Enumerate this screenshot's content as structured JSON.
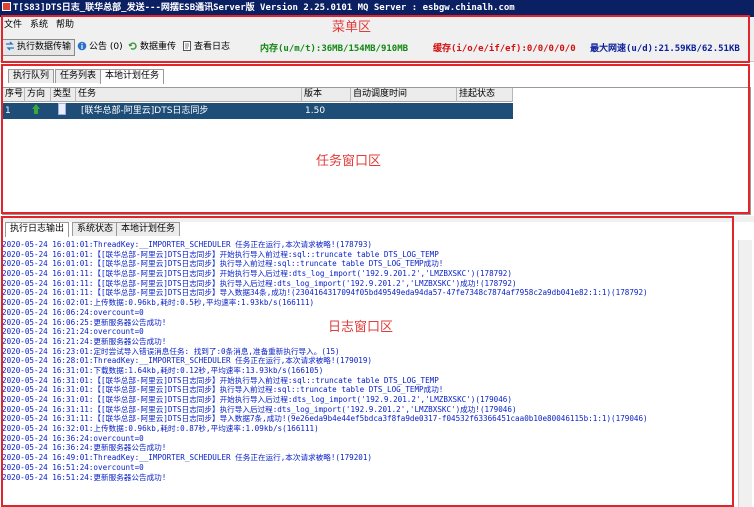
{
  "window": {
    "title": "T[S83]DTS日志_联华总部_发送---网摆ESB通讯Server版  Version 2.25.0101 MQ Server : esbgw.chinalh.com"
  },
  "menu": [
    "文件",
    "系统",
    "帮助"
  ],
  "toolbar": {
    "buttons": [
      {
        "label": "执行数据传输",
        "icon": "transfer-icon"
      },
      {
        "label": "公告 (0)",
        "icon": "info-icon"
      },
      {
        "label": "数据重传",
        "icon": "resend-icon"
      },
      {
        "label": "查看日志",
        "icon": "document-icon"
      }
    ],
    "memory": "内存(u/m/t):36MB/154MB/910MB",
    "cache": "缓存(i/o/e/if/ef):0/0/0/0/0",
    "speed": "最大网速(u/d):21.59KB/62.51KB"
  },
  "annotations": {
    "menu_area": "菜单区",
    "task_area": "任务窗口区",
    "log_area": "日志窗口区"
  },
  "colors": {
    "title_bg": "#0b1f63",
    "selected_row": "#1e4d78",
    "stat_green": "#118811",
    "stat_red": "#d01010",
    "stat_blue": "#0b1f9a",
    "log_text": "#0a22c9",
    "annotation_red": "#e0262b"
  },
  "task_tabs": [
    "执行队列",
    "任务列表",
    "本地计划任务"
  ],
  "task_table": {
    "headers": [
      "序号",
      "方向",
      "类型",
      "任务",
      "版本",
      "自动调度时间",
      "挂起状态"
    ],
    "rows": [
      {
        "index": "1",
        "direction_icon": "upload-arrow-icon",
        "type_icon": "file-icon",
        "task": "[联华总部-阿里云]DTS日志同步",
        "version": "1.50",
        "schedule": "",
        "suspend": ""
      }
    ]
  },
  "log_tabs": [
    "执行日志输出",
    "系统状态",
    "本地计划任务"
  ],
  "log_lines": [
    "2020-05-24 16:01:01:ThreadKey:__IMPORTER_SCHEDULER 任务正在运行,本次请求被略!(178793)",
    "2020-05-24 16:01:01:【[联华总部-阿里云]DTS日志同步】开始执行导入前过程:sql::truncate table DTS_LOG_TEMP",
    "2020-05-24 16:01:01:【[联华总部-阿里云]DTS日志同步】执行导入前过程:sql::truncate table DTS_LOG_TEMP成功!",
    "2020-05-24 16:01:11:【[联华总部-阿里云]DTS日志同步】开始执行导入后过程:dts_log_import('192.9.201.2','LMZBXSKC')(178792)",
    "2020-05-24 16:01:11:【[联华总部-阿里云]DTS日志同步】执行导入后过程:dts_log_import('192.9.201.2','LMZBXSKC')成功!(178792)",
    "2020-05-24 16:01:11:【[联华总部-阿里云]DTS日志同步】导入数据34条,成功!(2304164317094f05bd49549eda94da57-47fe7348c7874af7958c2a9db041e82:1:1)(178792)",
    "2020-05-24 16:02:01:上传数据:0.96kb,耗时:0.5秒,平均速率:1.93kb/s(166111)",
    "2020-05-24 16:06:24:overcount=0",
    "2020-05-24 16:06:25:更新服务器公告成功!",
    "2020-05-24 16:21:24:overcount=0",
    "2020-05-24 16:21:24:更新服务器公告成功!",
    "2020-05-24 16:23:01:定时尝试导入错误消息任务: 找到了:0条消息,准备重新执行导入。(15)",
    "2020-05-24 16:28:01:ThreadKey:__IMPORTER_SCHEDULER 任务正在运行,本次请求被略!(179019)",
    "2020-05-24 16:31:01:下载数据:1.64kb,耗时:0.12秒,平均速率:13.93kb/s(166105)",
    "2020-05-24 16:31:01:【[联华总部-阿里云]DTS日志同步】开始执行导入前过程:sql::truncate table DTS_LOG_TEMP",
    "2020-05-24 16:31:01:【[联华总部-阿里云]DTS日志同步】执行导入前过程:sql::truncate table DTS_LOG_TEMP成功!",
    "2020-05-24 16:31:01:【[联华总部-阿里云]DTS日志同步】开始执行导入后过程:dts_log_import('192.9.201.2','LMZBXSKC')(179046)",
    "2020-05-24 16:31:11:【[联华总部-阿里云]DTS日志同步】执行导入后过程:dts_log_import('192.9.201.2','LMZBXSKC')成功!(179046)",
    "2020-05-24 16:31:11:【[联华总部-阿里云]DTS日志同步】导入数据7条,成功!(9e26eda9b4e44ef5bdca3f8fa9de0317-f04532f63366451caa0b10e80046115b:1:1)(179046)",
    "2020-05-24 16:32:01:上传数据:0.96kb,耗时:0.87秒,平均速率:1.09kb/s(166111)",
    "2020-05-24 16:36:24:overcount=0",
    "2020-05-24 16:36:24:更新服务器公告成功!",
    "2020-05-24 16:49:01:ThreadKey:__IMPORTER_SCHEDULER 任务正在运行,本次请求被略!(179201)",
    "2020-05-24 16:51:24:overcount=0",
    "2020-05-24 16:51:24:更新服务器公告成功!"
  ]
}
